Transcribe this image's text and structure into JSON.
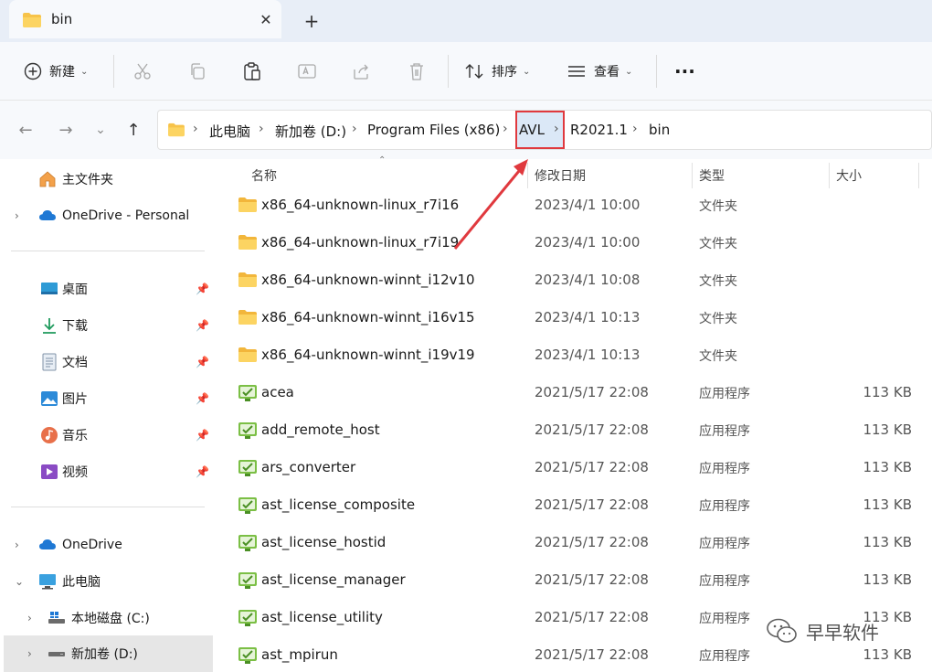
{
  "tab": {
    "title": "bin",
    "close": "✕",
    "new": "+"
  },
  "command_bar": {
    "new_label": "新建",
    "sort_label": "排序",
    "view_label": "查看",
    "more": "···"
  },
  "address": {
    "crumbs": [
      "此电脑",
      "新加卷 (D:)",
      "Program Files (x86)",
      "AVL",
      "R2021.1",
      "bin"
    ],
    "highlighted_crumb": "AVL"
  },
  "sidebar": {
    "home": "主文件夹",
    "onedrive_personal": "OneDrive - Personal",
    "quick": [
      {
        "label": "桌面",
        "icon": "desktop-icon"
      },
      {
        "label": "下载",
        "icon": "download-icon"
      },
      {
        "label": "文档",
        "icon": "document-icon"
      },
      {
        "label": "图片",
        "icon": "picture-icon"
      },
      {
        "label": "音乐",
        "icon": "music-icon"
      },
      {
        "label": "视频",
        "icon": "video-icon"
      }
    ],
    "onedrive": "OneDrive",
    "this_pc": "此电脑",
    "drive_c": "本地磁盘 (C:)",
    "drive_d": "新加卷 (D:)"
  },
  "columns": {
    "name": "名称",
    "date": "修改日期",
    "type": "类型",
    "size": "大小"
  },
  "files": [
    {
      "name": "x86_64-unknown-linux_r7i16",
      "date": "2023/4/1 10:00",
      "type": "文件夹",
      "size": "",
      "kind": "folder"
    },
    {
      "name": "x86_64-unknown-linux_r7i19",
      "date": "2023/4/1 10:00",
      "type": "文件夹",
      "size": "",
      "kind": "folder"
    },
    {
      "name": "x86_64-unknown-winnt_i12v10",
      "date": "2023/4/1 10:08",
      "type": "文件夹",
      "size": "",
      "kind": "folder"
    },
    {
      "name": "x86_64-unknown-winnt_i16v15",
      "date": "2023/4/1 10:13",
      "type": "文件夹",
      "size": "",
      "kind": "folder"
    },
    {
      "name": "x86_64-unknown-winnt_i19v19",
      "date": "2023/4/1 10:13",
      "type": "文件夹",
      "size": "",
      "kind": "folder"
    },
    {
      "name": "acea",
      "date": "2021/5/17 22:08",
      "type": "应用程序",
      "size": "113 KB",
      "kind": "app"
    },
    {
      "name": "add_remote_host",
      "date": "2021/5/17 22:08",
      "type": "应用程序",
      "size": "113 KB",
      "kind": "app"
    },
    {
      "name": "ars_converter",
      "date": "2021/5/17 22:08",
      "type": "应用程序",
      "size": "113 KB",
      "kind": "app"
    },
    {
      "name": "ast_license_composite",
      "date": "2021/5/17 22:08",
      "type": "应用程序",
      "size": "113 KB",
      "kind": "app"
    },
    {
      "name": "ast_license_hostid",
      "date": "2021/5/17 22:08",
      "type": "应用程序",
      "size": "113 KB",
      "kind": "app"
    },
    {
      "name": "ast_license_manager",
      "date": "2021/5/17 22:08",
      "type": "应用程序",
      "size": "113 KB",
      "kind": "app"
    },
    {
      "name": "ast_license_utility",
      "date": "2021/5/17 22:08",
      "type": "应用程序",
      "size": "113 KB",
      "kind": "app"
    },
    {
      "name": "ast_mpirun",
      "date": "2021/5/17 22:08",
      "type": "应用程序",
      "size": "113 KB",
      "kind": "app"
    }
  ],
  "watermark": "早早软件",
  "colors": {
    "highlight_border": "#e0393e",
    "folder": "#f7c34a",
    "app_icon": "#6cb33e"
  }
}
